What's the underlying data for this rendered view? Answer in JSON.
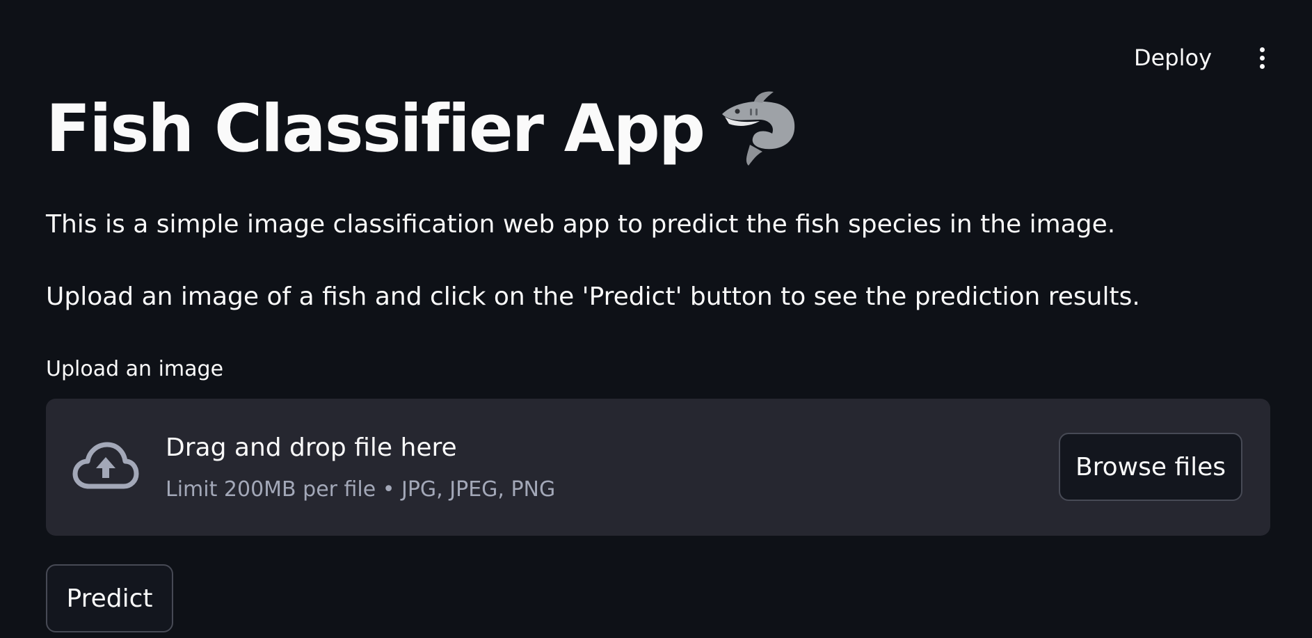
{
  "header": {
    "deploy_label": "Deploy",
    "menu_icon": "kebab-menu-icon"
  },
  "main": {
    "title": "Fish Classifier App",
    "title_emoji_icon": "shark-icon",
    "description_1": "This is a simple image classification web app to predict the fish species in the image.",
    "description_2": "Upload an image of a fish and click on the 'Predict' button to see the prediction results."
  },
  "uploader": {
    "label": "Upload an image",
    "dropzone_title": "Drag and drop file here",
    "dropzone_subtitle": "Limit 200MB per file • JPG, JPEG, PNG",
    "browse_label": "Browse files",
    "upload_icon": "cloud-upload-icon"
  },
  "actions": {
    "predict_label": "Predict"
  },
  "colors": {
    "background": "#0e1117",
    "dropzone_bg": "#262730",
    "text": "#fafafa",
    "muted_text": "#a3a8b8",
    "button_border": "#474a55"
  }
}
